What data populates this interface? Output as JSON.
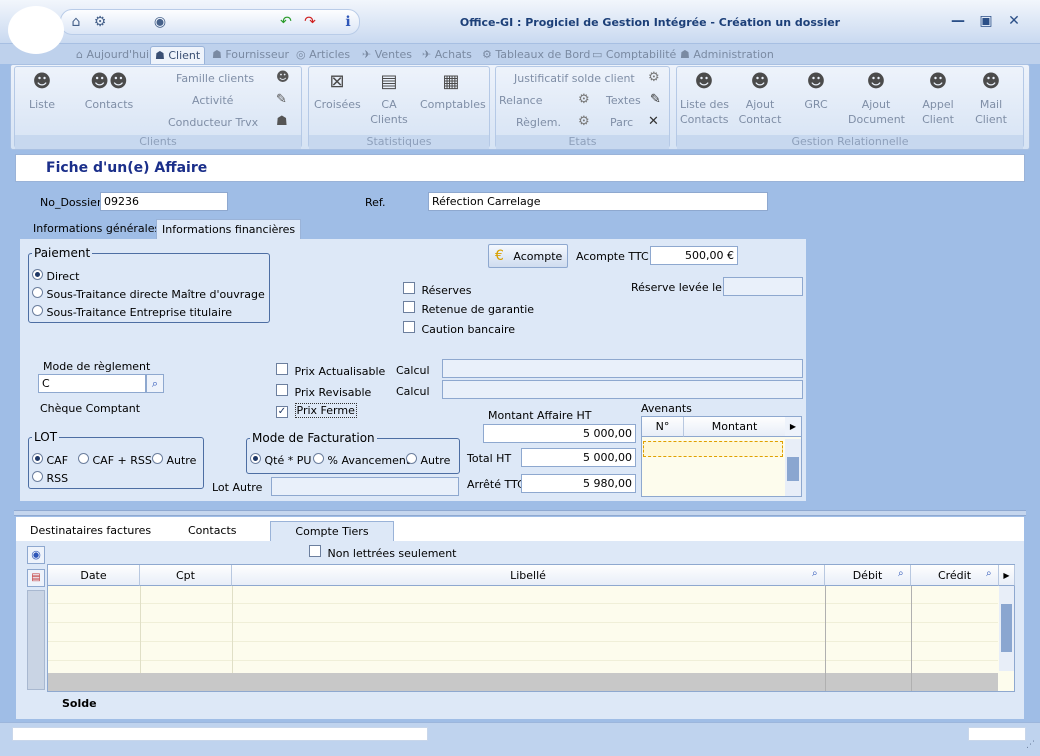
{
  "window": {
    "title": "Office-GI : Progiciel de Gestion Intégrée - Création un dossier"
  },
  "ribbon_tabs": [
    "Aujourd'hui",
    "Client",
    "Fournisseur",
    "Articles",
    "Ventes",
    "Achats",
    "Tableaux de Bord",
    "Comptabilité",
    "Administration"
  ],
  "ribbon": {
    "clients": {
      "group": "Clients",
      "liste": "Liste",
      "contacts": "Contacts",
      "famille": "Famille clients",
      "activite": "Activité",
      "conducteur": "Conducteur Trvx"
    },
    "stats": {
      "group": "Statistiques",
      "croisees": "Croisées",
      "ca1": "CA",
      "ca2": "Clients",
      "comptables": "Comptables"
    },
    "etats": {
      "group": "Etats",
      "justificatif": "Justificatif solde client",
      "relance": "Relance",
      "textes": "Textes",
      "reglem": "Règlem.",
      "parc": "Parc"
    },
    "gr": {
      "group": "Gestion Relationnelle",
      "liste1": "Liste des",
      "liste2": "Contacts",
      "ajout1": "Ajout",
      "ajout2": "Contact",
      "grc": "GRC",
      "ajdoc1": "Ajout",
      "ajdoc2": "Document",
      "appel1": "Appel",
      "appel2": "Client",
      "mail1": "Mail",
      "mail2": "Client"
    }
  },
  "form": {
    "heading": "Fiche d'un(e) Affaire",
    "no_dossier_label": "No_Dossier",
    "no_dossier": "09236",
    "ref_label": "Ref.",
    "ref": "Réfection Carrelage",
    "tabs": [
      "Informations générales",
      "Informations financières"
    ],
    "paiement": {
      "legend": "Paiement",
      "options": [
        "Direct",
        "Sous-Traitance directe Maître d'ouvrage",
        "Sous-Traitance Entreprise titulaire"
      ]
    },
    "acompte_btn": "Acompte",
    "acompte_ttc_label": "Acompte TTC",
    "acompte_ttc": "500,00 €",
    "reserve_levee_label": "Réserve levée le",
    "reserves": "Réserves",
    "retenue": "Retenue de garantie",
    "caution": "Caution bancaire",
    "mode_reglement_label": "Mode de règlement",
    "mode_reglement": "C",
    "mode_reglement_desc": "Chèque Comptant",
    "prix_actualisable": "Prix Actualisable",
    "prix_revisable": "Prix Revisable",
    "prix_ferme": "Prix Ferme",
    "calcul": "Calcul",
    "lot": {
      "legend": "LOT",
      "caf": "CAF",
      "caf_rss": "CAF + RSS",
      "autre": "Autre",
      "rss": "RSS"
    },
    "mode_fact": {
      "legend": "Mode de Facturation",
      "qte": "Qté * PU",
      "avancement": "% Avancement",
      "autre": "Autre"
    },
    "lot_autre_label": "Lot Autre",
    "montant_ht_label": "Montant Affaire HT",
    "montant_ht": "5 000,00",
    "total_ht_label": "Total HT",
    "total_ht": "5 000,00",
    "arrete_ttc_label": "Arrêté TTC",
    "arrete_ttc": "5 980,00",
    "avenants": {
      "label": "Avenants",
      "col_no": "N°",
      "col_montant": "Montant"
    }
  },
  "lower": {
    "tabs": [
      "Destinataires factures",
      "Contacts",
      "Compte Tiers"
    ],
    "non_lettrees": "Non lettrées seulement",
    "columns": [
      "Date",
      "Cpt",
      "Libellé",
      "Débit",
      "Crédit"
    ],
    "solde": "Solde"
  }
}
